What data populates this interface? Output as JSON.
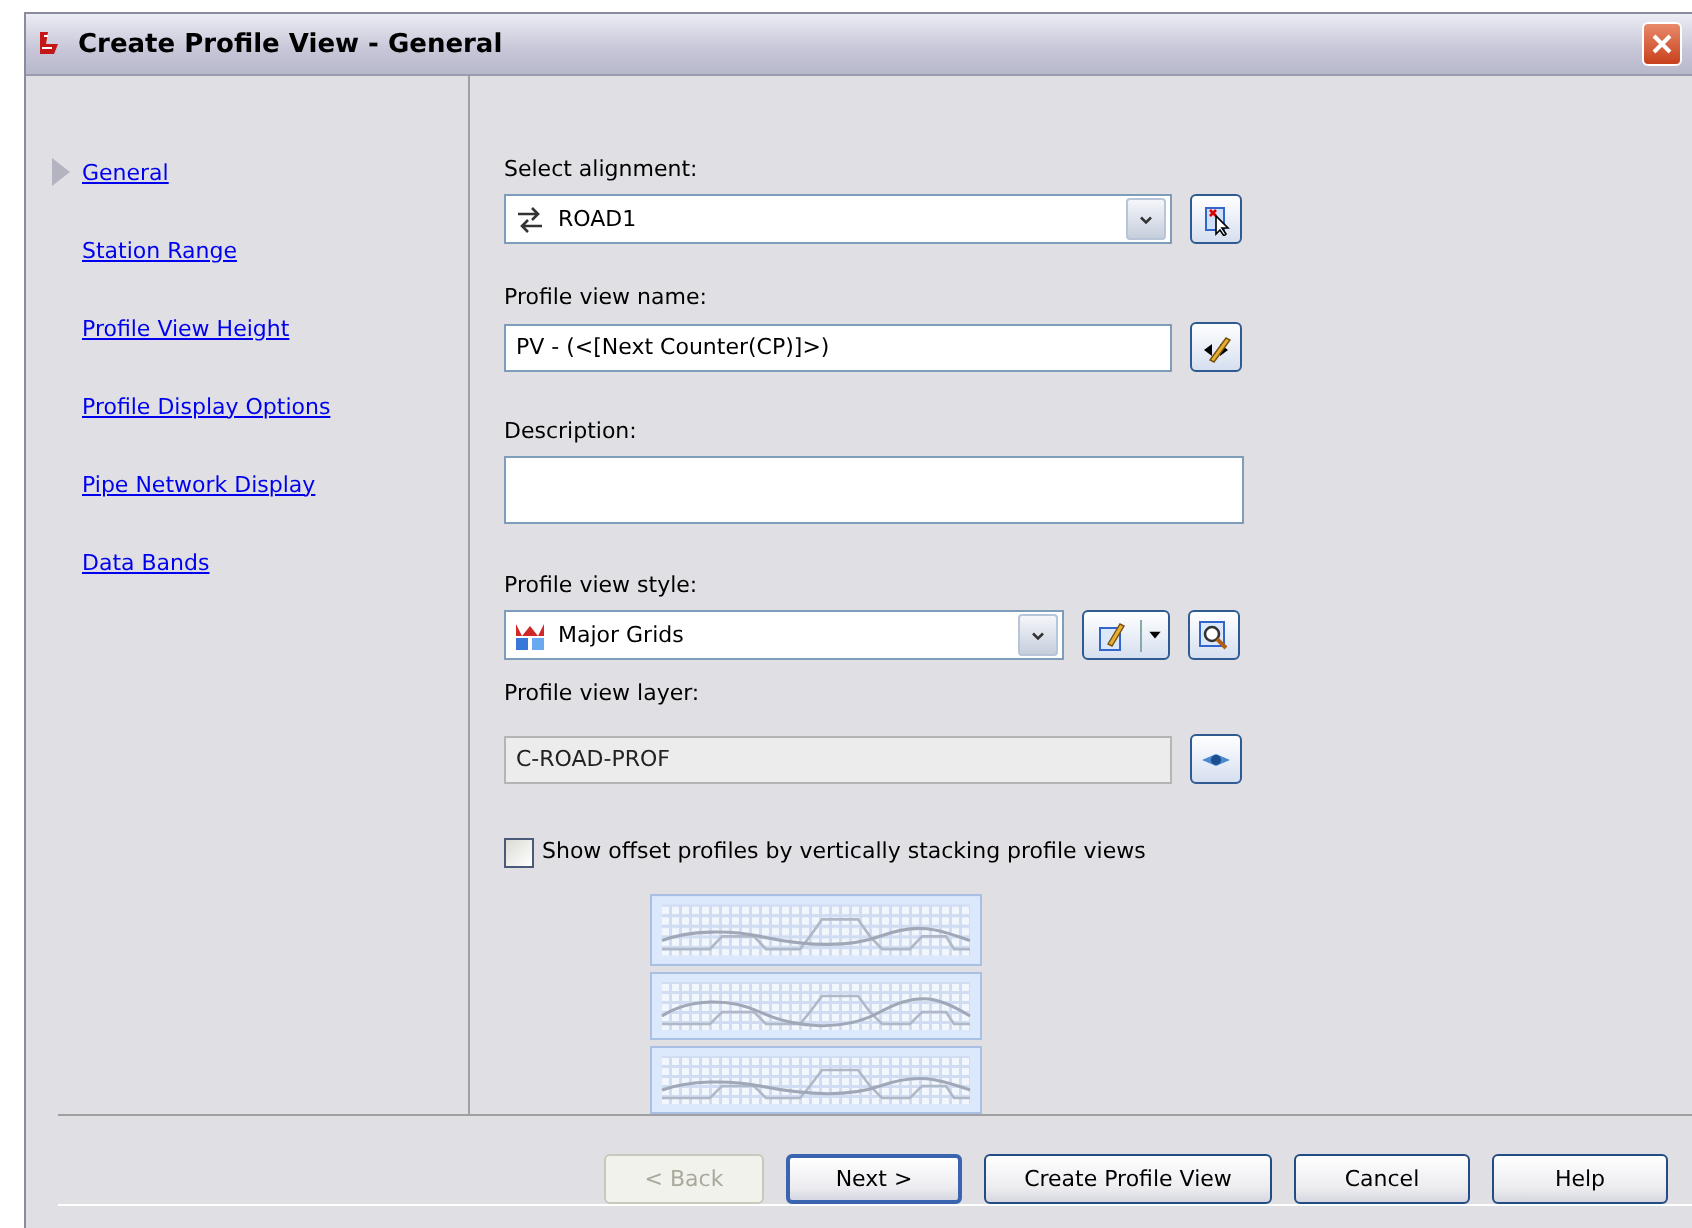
{
  "window": {
    "title": "Create Profile View - General"
  },
  "nav": [
    {
      "label": "General",
      "selected": true
    },
    {
      "label": "Station Range",
      "selected": false
    },
    {
      "label": "Profile View Height",
      "selected": false
    },
    {
      "label": "Profile Display Options",
      "selected": false
    },
    {
      "label": "Pipe Network Display",
      "selected": false
    },
    {
      "label": "Data Bands",
      "selected": false
    }
  ],
  "alignment": {
    "label": "Select alignment:",
    "value": "ROAD1"
  },
  "name": {
    "label": "Profile view name:",
    "value": "PV - (<[Next Counter(CP)]>)"
  },
  "description": {
    "label": "Description:"
  },
  "style": {
    "label": "Profile view style:",
    "value": "Major Grids"
  },
  "layer": {
    "label": "Profile view layer:",
    "value": "C-ROAD-PROF",
    "disabled": true
  },
  "stacking": {
    "label": "Show offset profiles by vertically stacking profile views",
    "checked": false
  },
  "previews": [
    {
      "kind": "gentle"
    },
    {
      "kind": "wavy"
    },
    {
      "kind": "gentle"
    }
  ],
  "buttons": [
    {
      "label": "< Back",
      "disabled": true,
      "default": false
    },
    {
      "label": "Next >",
      "disabled": false,
      "default": true
    },
    {
      "label": "Create Profile View",
      "disabled": false,
      "default": false
    },
    {
      "label": "Cancel",
      "disabled": false,
      "default": false
    },
    {
      "label": "Help",
      "disabled": false,
      "default": false
    }
  ]
}
